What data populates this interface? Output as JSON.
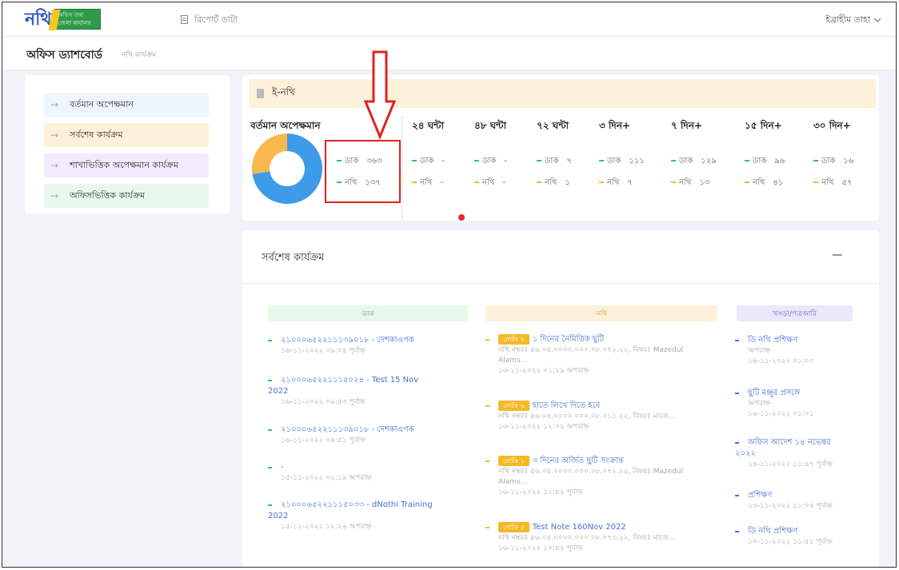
{
  "logo": {
    "main": "নথি",
    "sub1": "অফিস তথ্য",
    "sub2": "জেলা কার্যালয়"
  },
  "topbar": {
    "report": "রিপোর্ট ডাটা",
    "user": "ইব্রাহীম তাহা"
  },
  "subbar": {
    "title": "অফিস ড্যাশবোর্ড",
    "crumb": "নথি কার্যক্রম"
  },
  "sidebar": {
    "items": [
      {
        "label": "বর্তমান অপেক্ষমান",
        "bg": "#eef5fd"
      },
      {
        "label": "সর্বশেষ কার্যক্রম",
        "bg": "#fdf1d9"
      },
      {
        "label": "শাখাভিত্তিক অপেক্ষমান কার্যক্রম",
        "bg": "#f1ecfb"
      },
      {
        "label": "অফিসভিত্তিক কার্যক্রম",
        "bg": "#e8f8ec"
      }
    ]
  },
  "enothi": {
    "header": "ই-নথি",
    "current_label": "বর্তমান অপেক্ষমান",
    "current": {
      "dak_label": "ডাক",
      "dak": "৩৬৩",
      "nothi_label": "নথি",
      "nothi": "১৩৭"
    },
    "donut": {
      "segments": [
        {
          "label": "ডাক",
          "value": 363,
          "color": "#3d9be9"
        },
        {
          "label": "নথি",
          "value": 137,
          "color": "#f8b84e"
        }
      ]
    },
    "columns": [
      {
        "head": "২৪ ঘন্টা",
        "dak": "-",
        "nothi": "-"
      },
      {
        "head": "৪৮ ঘন্টা",
        "dak": "-",
        "nothi": "-"
      },
      {
        "head": "৭২ ঘন্টা",
        "dak": "৭",
        "nothi": "১"
      },
      {
        "head": "৩ দিন+",
        "dak": "১১১",
        "nothi": "৭"
      },
      {
        "head": "৭ দিন+",
        "dak": "১২৯",
        "nothi": "১৩"
      },
      {
        "head": "১৫ দিন+",
        "dak": "৯৬",
        "nothi": "৪১"
      },
      {
        "head": "৩০ দিন+",
        "dak": "১৬",
        "nothi": "৫৭"
      }
    ],
    "dak_label": "ডাক",
    "nothi_label": "নথি"
  },
  "latest": {
    "title": "সর্বশেষ কার্যক্রম",
    "col_dak": "ডাক",
    "col_nothi": "নথি",
    "col_draft": "খসড়া/পত্রজারি",
    "dak_items": [
      {
        "title": "২১০০০৬৫২২১১১৩৯০১৮ - দেশকাএগক",
        "meta": "১৬-১১-২০২২ ০৯:০৫ পূর্বাহ্ন"
      },
      {
        "title": "২১০০০৬৫২২১১১৫০২৪ - Test 15 Nov",
        "title2": "2022",
        "meta": "১৬-১১-২০২২ ০৯:৫৩ পূর্বাহ্ন"
      },
      {
        "title": "২১০০০৬৫২২১১১৩৯০১৮ - দেশকাএগক",
        "meta": "১৬-১১-২০২২ ০৯:৫১ পূর্বাহ্ন"
      },
      {
        "title": "-",
        "meta": "১৫-১১-২০২২ ০২:১৯ অপরাহ্ন"
      },
      {
        "title": "২১০০০৬৫২২১১১৫০৩৩ - dNothi Training",
        "title2": "2022",
        "meta": "১৫-১১-২০২২ ১২:২৬ অপরাহ্ন"
      }
    ],
    "nothi_items": [
      {
        "tag": "নোটঃ ২",
        "title": "১ দিনের নৈমিত্তিক ছুটি",
        "meta1": "নথি নম্বরঃ ৫৬.০৪.০০০০.০০০.০৮.০৭২.২২, বিষয়ঃ Mazedul",
        "meta2": "Alams...",
        "meta3": "১৬-১১-২০২২ ০১:২৯ অপরাহ্ন"
      },
      {
        "tag": "নোটঃ ৬",
        "title": "হাতে লিখে দিতে হবে",
        "meta1": "নথি নম্বরঃ ৫৬.০৪.০০০০.০০০.০৮.০১১.২২, বিষয়ঃ মাজে...",
        "meta3": "১৬-১১-২০২২ ১২:০২ অপরাহ্ন"
      },
      {
        "tag": "নোটঃ ১",
        "title": "৩ দিনের অর্জিত ছুটি সংক্রান্ত",
        "meta1": "নথি নম্বরঃ ৫৬.০৪.০০০০.০০০.০৮.০৭২.২২, বিষয়ঃ Mazedul",
        "meta2": "Alams...",
        "meta3": "১৬-১১-২০২২ ১১:৪২ পূর্বাহ্ন"
      },
      {
        "tag": "নোটঃ ৩",
        "title": "Test Note 160Nov 2022",
        "meta1": "নথি নম্বরঃ ৫৬.০৪.০০০০.০০০.০৮.০৭৩.২২, বিষয়ঃ মাজে...",
        "meta3": "১৬-১১-২০২২ ১০:৪২ পূর্বাহ্ন"
      }
    ],
    "draft_items": [
      {
        "title": "ডি নথি প্রশিক্ষণ",
        "meta": "১৬-১১-২০২২ ০১:০০",
        "meta2": "অপরাহ্ন"
      },
      {
        "title": "ছুটি মঞ্জুর প্রসঙ্গে",
        "meta": "১৬-১১-২০২২ ০১:০১",
        "meta2": "অপরাহ্ন"
      },
      {
        "title": "অফিস আদেশ ১৪ নভেম্বর",
        "title2": "২০২২",
        "meta": "১৪-১১-২০২২ ১১:৪৭ পূর্বাহ্ন"
      },
      {
        "title": "প্রশিক্ষণ",
        "meta": "১৩-১১-২০২২ ১১:০৪ পূর্বাহ্ন"
      },
      {
        "title": "ডি নথি প্রশিক্ষণ",
        "meta": "১০-১১-২০২২ ১১:৫১ পূর্বাহ্ন"
      }
    ]
  },
  "colors": {
    "accent_blue": "#3d9be9",
    "accent_orange": "#f8b84e",
    "highlight_red": "#e02222",
    "bullet_green": "#3bbf6a",
    "tag_yellow": "#f4b928"
  },
  "icons": {
    "report": "document-icon",
    "user_menu": "chevron-down-icon",
    "sidebar_arrow": "arrow-right-icon",
    "enothi": "document-icon"
  }
}
